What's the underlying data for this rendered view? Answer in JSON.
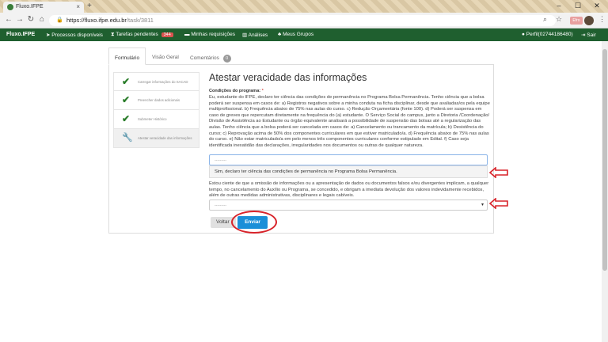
{
  "browser": {
    "tab_title": "Fluxo.IFPE",
    "tab_close": "×",
    "new_tab": "+",
    "window_controls": [
      "–",
      "☐",
      "✕"
    ],
    "nav_back": "←",
    "nav_forward": "→",
    "nav_reload": "↻",
    "nav_home": "⌂",
    "url_host": "https://fluxo.ifpe.edu.br",
    "url_path": "/task/3811",
    "profile_label": "Efro"
  },
  "appnav": {
    "brand": "Fluxo.IFPE",
    "processos": "Processos disponíveis",
    "tarefas": "Tarefas pendentes",
    "tarefas_count": "344",
    "requisicoes": "Minhas requisições",
    "analises": "Análises",
    "grupos": "Meus Grupos",
    "perfil": "Perfil(02744186480)",
    "sair": "Sair"
  },
  "tabs": {
    "formulario": "Formulário",
    "visao_geral": "Visão Geral",
    "comentarios": "Comentários",
    "comentarios_count": "0"
  },
  "steps": [
    {
      "label": "Carregar informações do SACAD",
      "icon": "check-icon"
    },
    {
      "label": "Preencher dados adicionais",
      "icon": "check-icon"
    },
    {
      "label": "Submeter Histórico",
      "icon": "check-icon"
    },
    {
      "label": "Atestar veracidade das informações",
      "icon": "wrench-icon"
    }
  ],
  "form": {
    "title": "Atestar veracidade das informações",
    "conditions_label": "Condições do programa:",
    "required_mark": "*",
    "conditions_text": "Eu, estudante do IFPE, declaro ter ciência das condições de permanência no Programa Bolsa Permanência. Tenho ciência que a bolsa poderá ser suspensa em casos de: a) Registros negativos sobre a minha conduta na ficha disciplinar, desde que avaliadas/os pela equipe multiprofissional. b) Frequência abaixo de 75% nas aulas do curso. c) Redução Orçamentária (fonte 100). d) Poderá ser suspensa em caso de greves que repercutam diretamente na frequência do (a) estudante. O Serviço Social do campus, junto a Diretoria /Coordenação/ Divisão de Assistência ao Estudante ou órgão equivalente analisará a possibilidade de suspensão das bolsas até a regularização das aulas. Tenho ciência que a bolsa poderá ser cancelada em casos de: a) Cancelamento ou trancamento da matrícula; b) Desistência do curso; c) Reprovação acima de 50% dos componentes curriculares em que estiver matriculado/a. d) Frequência abaixo de 75% nas aulas do curso. e) Não estar matriculado/a em pelo menos três componentes curriculares conforme estipulado em Edital. f) Caso seja identificada inexatidão das declarações, irregularidades nos documentos ou outras de qualquer natureza.",
    "select1_placeholder": "---------",
    "select1_option": "Sim, declaro ter ciência das condições de permanência no Programa Bolsa Permanência.",
    "declaration_text": "Estou ciente de que a omissão de informações ou a apresentação de dados ou documentos falsos e/ou divergentes implicam, a qualquer tempo, no cancelamento do Auxílio ou Programa, se concedido, e obrigam a imediata devolução dos valores indevidamente recebidos, além de outras medidas administrativas, disciplinares e legais cabíveis.",
    "select2_placeholder": "---------",
    "caret": "▾",
    "back_label": "Voltar",
    "submit_label": "Enviar"
  },
  "colors": {
    "nav_green": "#1f5f2f",
    "submit_blue": "#1a8fd8",
    "annotation_red": "#d8232a",
    "check_green": "#2a7d2a"
  }
}
